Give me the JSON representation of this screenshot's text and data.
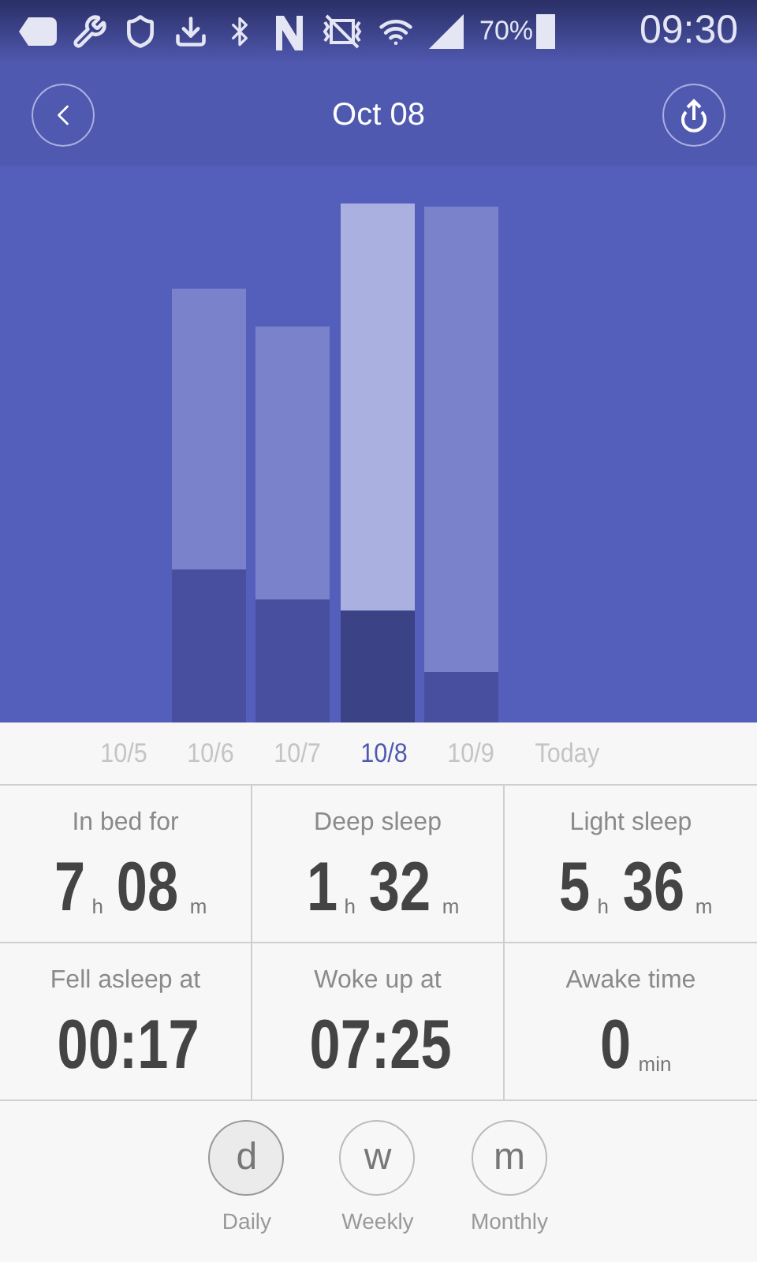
{
  "status_bar": {
    "battery": "70%",
    "time": "09:30"
  },
  "header": {
    "title": "Oct 08"
  },
  "dates": [
    {
      "label": "10/5",
      "selected": false
    },
    {
      "label": "10/6",
      "selected": false
    },
    {
      "label": "10/7",
      "selected": false
    },
    {
      "label": "10/8",
      "selected": true
    },
    {
      "label": "10/9",
      "selected": false
    },
    {
      "label": "Today",
      "selected": false
    }
  ],
  "stats": [
    {
      "label": "In bed for",
      "value": [
        {
          "num": "7",
          "unit": "h"
        },
        {
          "num": "08",
          "unit": "m"
        }
      ]
    },
    {
      "label": "Deep sleep",
      "value": [
        {
          "num": "1",
          "unit": "h"
        },
        {
          "num": "32",
          "unit": "m"
        }
      ]
    },
    {
      "label": "Light sleep",
      "value": [
        {
          "num": "5",
          "unit": "h"
        },
        {
          "num": "36",
          "unit": "m"
        }
      ]
    },
    {
      "label": "Fell asleep at",
      "value": [
        {
          "num": "00:17"
        }
      ]
    },
    {
      "label": "Woke up at",
      "value": [
        {
          "num": "07:25"
        }
      ]
    },
    {
      "label": "Awake time",
      "value": [
        {
          "num": "0",
          "unit": "min"
        }
      ]
    }
  ],
  "periods": [
    {
      "letter": "d",
      "label": "Daily",
      "selected": true
    },
    {
      "letter": "w",
      "label": "Weekly",
      "selected": false
    },
    {
      "letter": "m",
      "label": "Monthly",
      "selected": false
    }
  ]
}
